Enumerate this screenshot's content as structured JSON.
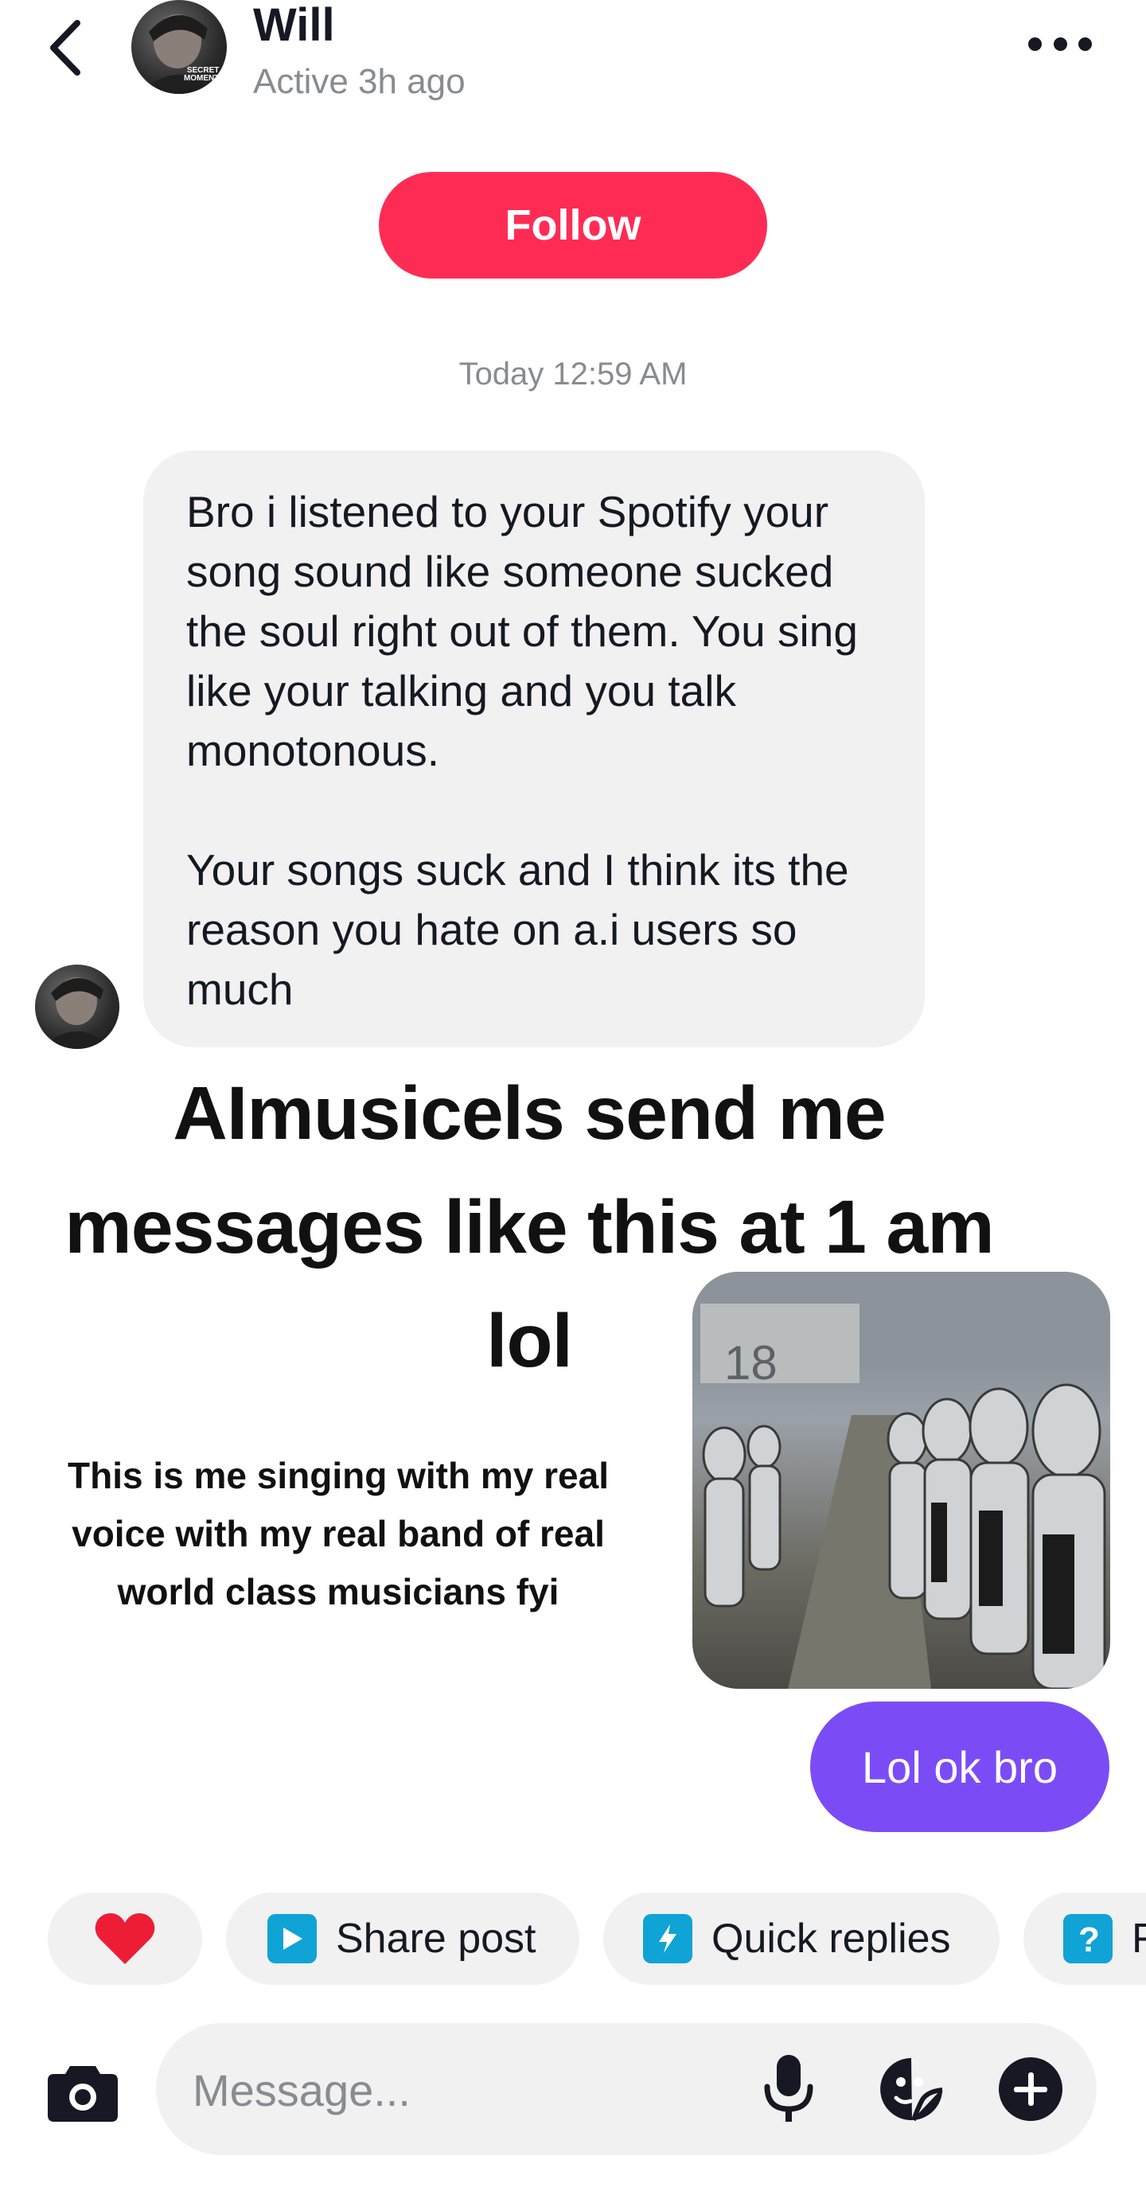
{
  "header": {
    "name": "Will",
    "status": "Active 3h ago",
    "avatar_tag": "SECRET MOMENT"
  },
  "follow_label": "Follow",
  "timestamp": "Today 12:59 AM",
  "incoming_message": "Bro i listened to your Spotify your song sound like someone sucked the soul right out of them. You sing like your talking and you talk monotonous.\n\nYour songs suck and I think its the reason you hate on a.i users so much",
  "overlay": {
    "title": "AImusicels send me messages like this at 1 am lol",
    "caption": "This is me singing with my real voice with my real band of real world class musicians fyi"
  },
  "outgoing_message": "Lol ok bro",
  "quick_actions": [
    {
      "label": "",
      "icon": "heart-icon"
    },
    {
      "label": "Share post",
      "icon": "play-icon"
    },
    {
      "label": "Quick replies",
      "icon": "lightning-icon"
    },
    {
      "label": "F",
      "icon": "question-icon"
    }
  ],
  "composer": {
    "placeholder": "Message..."
  },
  "colors": {
    "follow": "#fe2c55",
    "outgoing_bubble": "#7b4cf6",
    "incoming_bubble": "#f1f1f2",
    "chip_icon": "#0fa3d6"
  }
}
